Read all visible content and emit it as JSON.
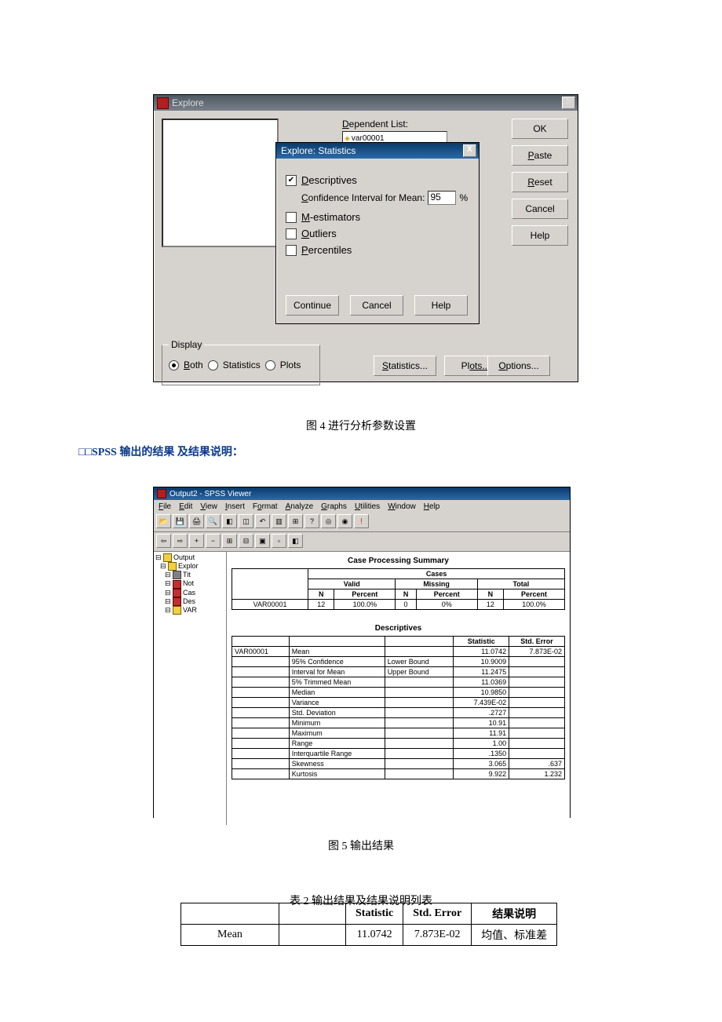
{
  "explore": {
    "title": "Explore",
    "close_x": "X",
    "dependent_label_pre": "D",
    "dependent_label_post": "ependent List:",
    "dependent_item_prefix": "◈",
    "dependent_item": "var00001",
    "buttons": {
      "ok": "OK",
      "paste_pre": "P",
      "paste_post": "aste",
      "reset_pre": "R",
      "reset_post": "eset",
      "cancel": "Cancel",
      "help": "Help",
      "statistics_pre": "S",
      "statistics_post": "tatistics...",
      "plots_pre": "Pl",
      "plots_post": "ots...",
      "options_pre": "O",
      "options_post": "ptions..."
    },
    "display": {
      "legend": "Display",
      "both_pre": "B",
      "both_post": "oth",
      "stats": "Statistics",
      "plots": "Plots"
    }
  },
  "explore_stats_sub": {
    "title": "Explore: Statistics",
    "close_x": "X",
    "descriptives_pre": "D",
    "descriptives_post": "escriptives",
    "ci_label_pre": "C",
    "ci_label_post": "onfidence Interval for Mean:",
    "ci_value": "95",
    "ci_pct": "%",
    "m_pre": "M",
    "m_post": "-estimators",
    "out_pre": "O",
    "out_post": "utliers",
    "pct_pre": "P",
    "pct_post": "ercentiles",
    "continue": "Continue",
    "cancel": "Cancel",
    "help": "Help"
  },
  "captions": {
    "fig4": "图 4    进行分析参数设置",
    "fig5": "图 5   输出结果",
    "tab2": "表 2  输出结果及结果说明列表"
  },
  "heading_blue": "□□SPSS 输出的结果  及结果说明：",
  "viewer": {
    "title": "Output2 - SPSS Viewer",
    "menu": [
      "File",
      "Edit",
      "View",
      "Insert",
      "Format",
      "Analyze",
      "Graphs",
      "Utilities",
      "Window",
      "Help"
    ],
    "menu_u": [
      "F",
      "E",
      "V",
      "I",
      "o",
      "A",
      "G",
      "U",
      "W",
      "H"
    ],
    "tree": [
      "Output",
      " Explor",
      "  Tit",
      "  Not",
      "  Cas",
      "  Des",
      "  VAR"
    ],
    "case_title": "Case Processing Summary",
    "case_headers": {
      "cases": "Cases",
      "valid": "Valid",
      "missing": "Missing",
      "total": "Total",
      "n": "N",
      "percent": "Percent"
    },
    "case_row": {
      "var": "VAR00001",
      "valid_n": "12",
      "valid_p": "100.0%",
      "miss_n": "0",
      "miss_p": "0%",
      "tot_n": "12",
      "tot_p": "100.0%"
    },
    "desc_title": "Descriptives",
    "desc_headers": {
      "statistic": "Statistic",
      "stderr": "Std. Error"
    },
    "desc_rows": [
      {
        "var": "VAR00001",
        "label": "Mean",
        "sub": "",
        "stat": "11.0742",
        "se": "7.873E-02"
      },
      {
        "var": "",
        "label": "95% Confidence",
        "sub": "Lower Bound",
        "stat": "10.9009",
        "se": ""
      },
      {
        "var": "",
        "label": "Interval for Mean",
        "sub": "Upper Bound",
        "stat": "11.2475",
        "se": ""
      },
      {
        "var": "",
        "label": "5% Trimmed Mean",
        "sub": "",
        "stat": "11.0369",
        "se": ""
      },
      {
        "var": "",
        "label": "Median",
        "sub": "",
        "stat": "10.9850",
        "se": ""
      },
      {
        "var": "",
        "label": "Variance",
        "sub": "",
        "stat": "7.439E-02",
        "se": ""
      },
      {
        "var": "",
        "label": "Std. Deviation",
        "sub": "",
        "stat": ".2727",
        "se": ""
      },
      {
        "var": "",
        "label": "Minimum",
        "sub": "",
        "stat": "10.91",
        "se": ""
      },
      {
        "var": "",
        "label": "Maximum",
        "sub": "",
        "stat": "11.91",
        "se": ""
      },
      {
        "var": "",
        "label": "Range",
        "sub": "",
        "stat": "1.00",
        "se": ""
      },
      {
        "var": "",
        "label": "Interquartile Range",
        "sub": "",
        "stat": ".1350",
        "se": ""
      },
      {
        "var": "",
        "label": "Skewness",
        "sub": "",
        "stat": "3.065",
        "se": ".637"
      },
      {
        "var": "",
        "label": "Kurtosis",
        "sub": "",
        "stat": "9.922",
        "se": "1.232"
      }
    ]
  },
  "doc_table": {
    "h_stat": "Statistic",
    "h_se": "Std. Error",
    "h_desc": "结果说明",
    "r_mean": "Mean",
    "r_stat": "11.0742",
    "r_se": "7.873E-02",
    "r_desc": "均值、标准差"
  }
}
